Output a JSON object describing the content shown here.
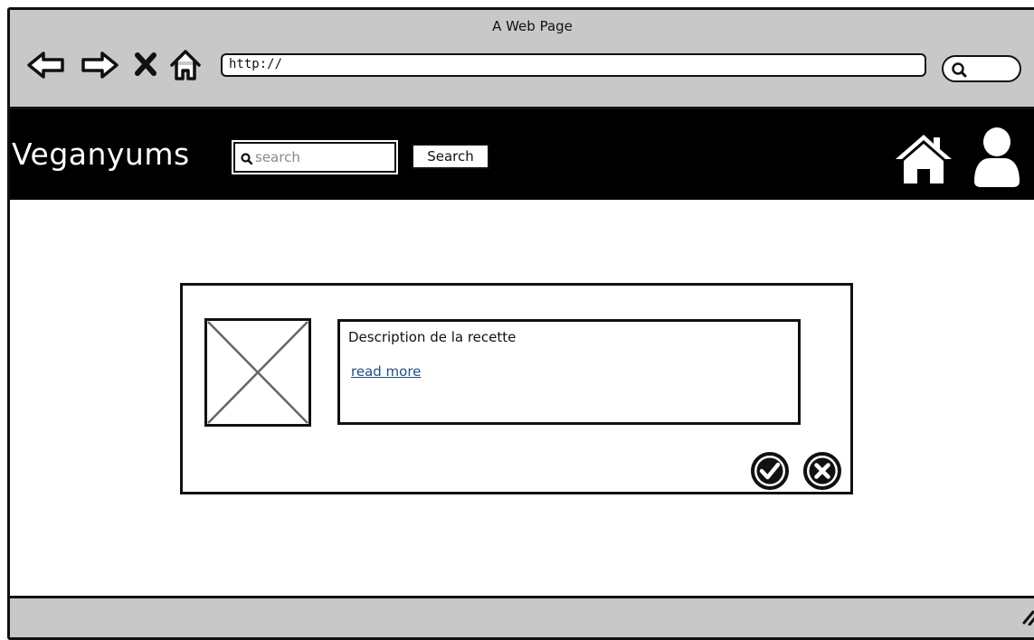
{
  "browser": {
    "window_title": "A Web Page",
    "url": "http://",
    "icons": {
      "back": "arrow-left-icon",
      "forward": "arrow-right-icon",
      "stop": "close-icon",
      "home": "home-outline-icon",
      "search": "search-icon"
    }
  },
  "header": {
    "brand": "Veganyums",
    "search_placeholder": "search",
    "search_button_label": "Search",
    "icons": {
      "home": "home-icon",
      "user": "user-icon"
    }
  },
  "card": {
    "image_placeholder": "image-placeholder",
    "description": "Description de la recette",
    "read_more": "read more",
    "actions": {
      "accept": "check-circle-icon",
      "reject": "x-circle-icon"
    }
  },
  "colors": {
    "chrome": "#c8c8c8",
    "header_bg": "#000000",
    "link": "#1f4f96"
  }
}
